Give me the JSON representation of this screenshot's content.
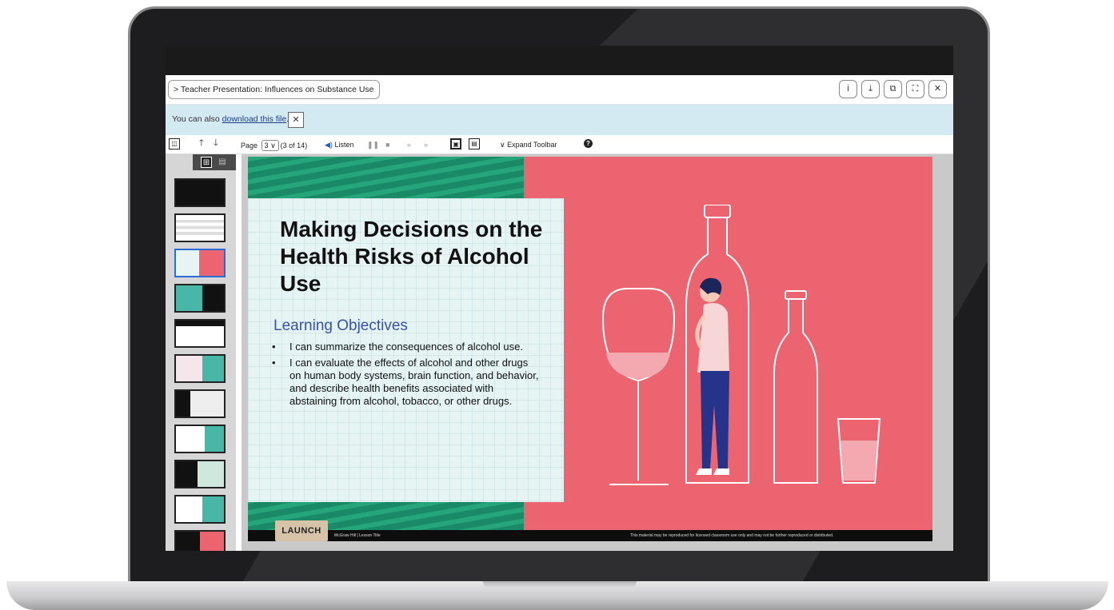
{
  "document": {
    "title_chevron": ">",
    "title": "Teacher Presentation: Influences on Substance Use",
    "window_buttons": [
      {
        "icon": "info-icon",
        "glyph": "i"
      },
      {
        "icon": "download-icon",
        "glyph": "⤓"
      },
      {
        "icon": "open-external-icon",
        "glyph": "⧉"
      },
      {
        "icon": "fullscreen-icon",
        "glyph": "⛶"
      },
      {
        "icon": "close-icon",
        "glyph": "✕"
      }
    ]
  },
  "notice": {
    "prefix": "You can also ",
    "link": "download this file",
    "suffix": ".",
    "close_glyph": "✕"
  },
  "toolbar": {
    "sidebar_toggle_glyph": "◫",
    "prev_glyph": "🡑",
    "next_glyph": "🡓",
    "page_label": "Page",
    "page_value": "3",
    "page_caret": "∨",
    "page_count": "(3 of 14)",
    "listen_glyph": "◀)",
    "listen_label": "Listen",
    "pause_glyph": "❚❚",
    "stop_glyph": "■",
    "rewind_glyph": "«",
    "forward_glyph": "»",
    "view_single_glyph": "▣",
    "view_double_glyph": "▤",
    "expand_caret": "∨",
    "expand_label": "Expand Toolbar",
    "help_glyph": "?"
  },
  "thumbnails": {
    "tab_grid_glyph": "⊞",
    "tab_list_glyph": "▤",
    "active_index": 2,
    "count_visible": 11
  },
  "slide": {
    "title": "Making Decisions on the Health Risks of Alcohol Use",
    "objectives_heading": "Learning Objectives",
    "bullet_glyph": "•",
    "objectives": [
      "I can summarize the consequences of alcohol use.",
      "I can evaluate the effects of alcohol and other drugs on human body systems, brain function, and behavior, and describe health benefits associated with abstaining from alcohol, tobacco, or other drugs."
    ],
    "launch_label": "LAUNCH",
    "footer_left": "McGraw Hill | Lesson Title",
    "footer_right": "This material may be reproduced for licensed classroom use only and may not be further reproduced or distributed.",
    "accent_color": "#ec6470",
    "pattern_color": "#1a8a66"
  }
}
